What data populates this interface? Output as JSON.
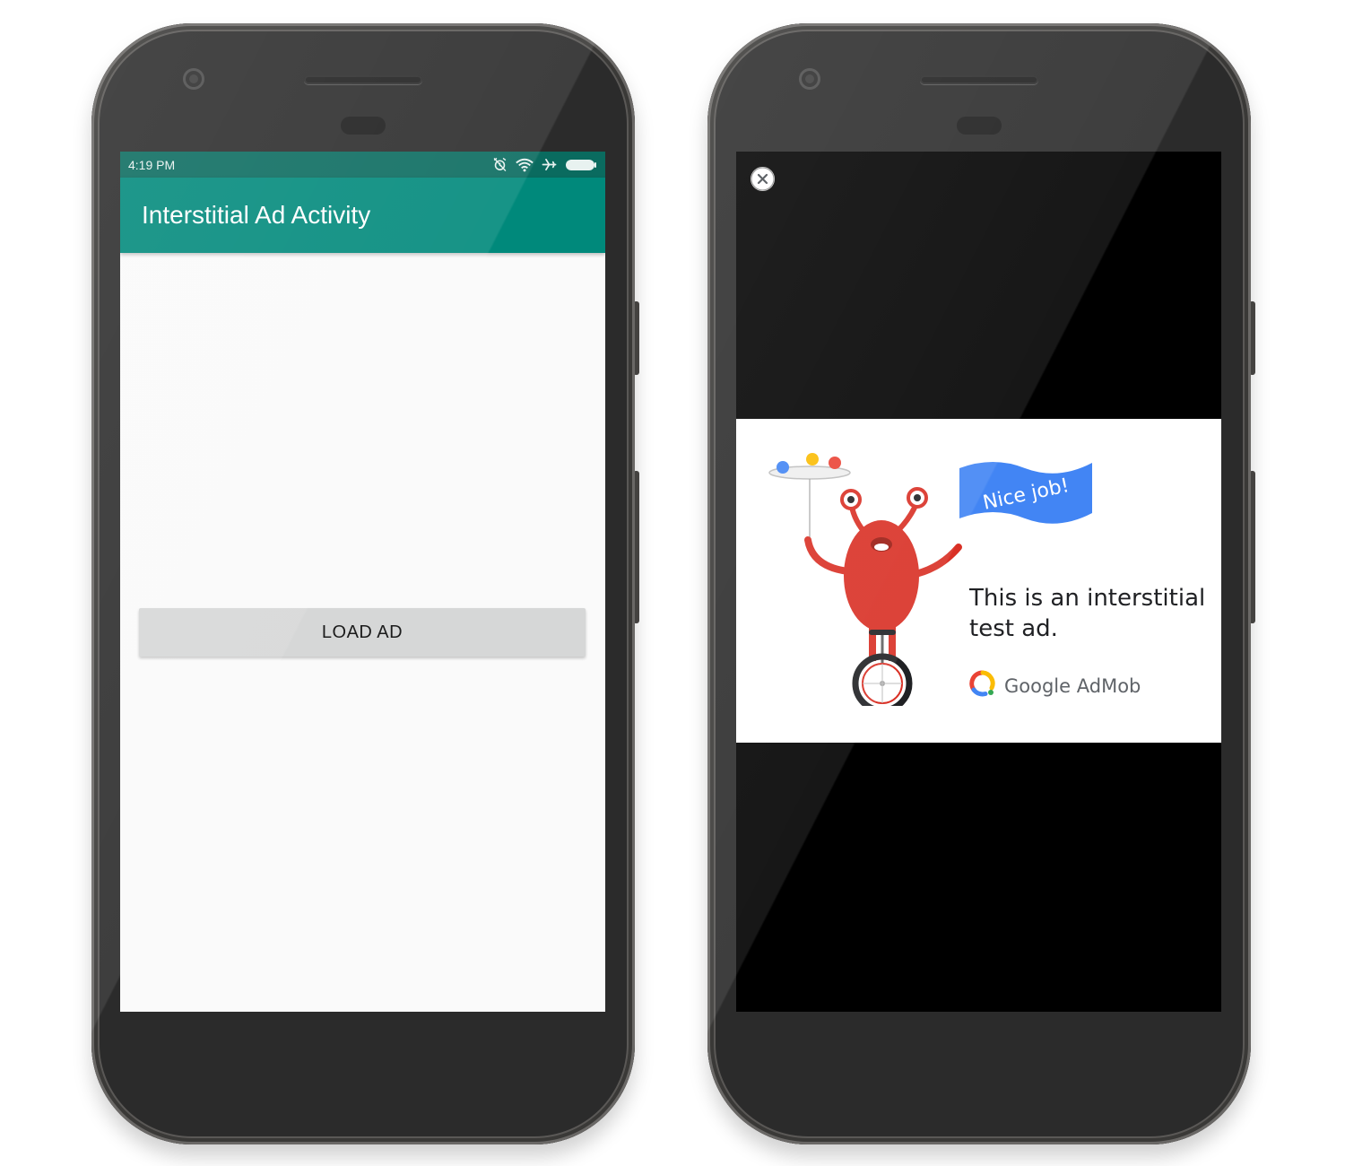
{
  "left_phone": {
    "status_bar": {
      "time": "4:19 PM",
      "icons": [
        "alarm-off-icon",
        "wifi-icon",
        "airplane-icon",
        "battery-icon"
      ]
    },
    "toolbar": {
      "title": "Interstitial Ad Activity"
    },
    "load_button_label": "LOAD AD"
  },
  "right_phone": {
    "close_icon": "close-icon",
    "ad": {
      "flag_text": "Nice job!",
      "headline": "This is an interstitial test ad.",
      "brand_google": "Google",
      "brand_admob": "AdMob",
      "colors": {
        "blue": "#4285f4",
        "yellow": "#fbbc04",
        "red": "#ea4335",
        "monster": "#d93025"
      }
    }
  },
  "colors": {
    "status_bar": "#0a6b5f",
    "toolbar": "#00897b",
    "screen_background": "#fafafa",
    "button": "#d6d7d7"
  }
}
